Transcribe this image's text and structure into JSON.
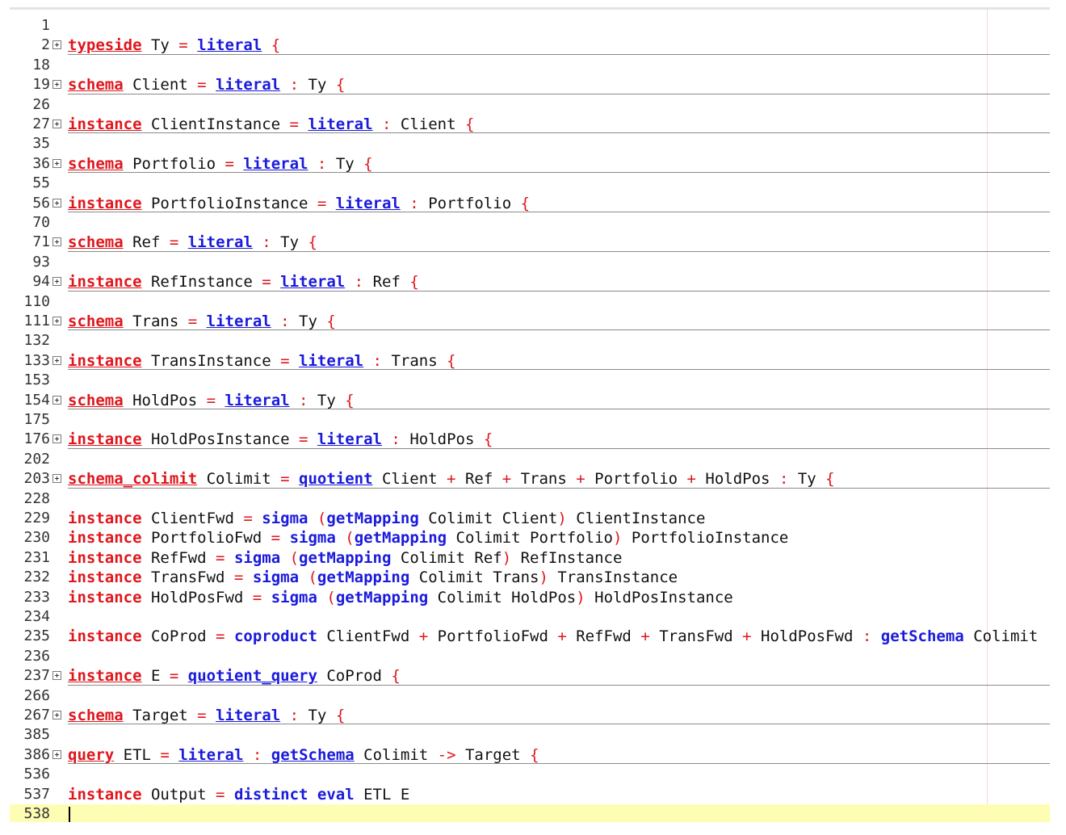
{
  "editor": {
    "current_line": "538",
    "lines": [
      {
        "num": "1",
        "fold": false,
        "tokens": []
      },
      {
        "num": "2",
        "fold": true,
        "tokens": [
          [
            "typeside",
            "kb"
          ],
          [
            " Ty ",
            ""
          ],
          [
            "=",
            "o"
          ],
          [
            " ",
            ""
          ],
          [
            "literal",
            "bb"
          ],
          [
            " ",
            ""
          ],
          [
            "{",
            "o"
          ]
        ]
      },
      {
        "num": "18",
        "fold": false,
        "tokens": []
      },
      {
        "num": "19",
        "fold": true,
        "tokens": [
          [
            "schema",
            "kb"
          ],
          [
            " Client ",
            ""
          ],
          [
            "=",
            "o"
          ],
          [
            " ",
            ""
          ],
          [
            "literal",
            "bb"
          ],
          [
            " ",
            ""
          ],
          [
            ":",
            "o"
          ],
          [
            " Ty ",
            ""
          ],
          [
            "{",
            "o"
          ]
        ]
      },
      {
        "num": "26",
        "fold": false,
        "tokens": []
      },
      {
        "num": "27",
        "fold": true,
        "tokens": [
          [
            "instance",
            "kb"
          ],
          [
            " ClientInstance ",
            ""
          ],
          [
            "=",
            "o"
          ],
          [
            " ",
            ""
          ],
          [
            "literal",
            "bb"
          ],
          [
            " ",
            ""
          ],
          [
            ":",
            "o"
          ],
          [
            " Client ",
            ""
          ],
          [
            "{",
            "o"
          ]
        ]
      },
      {
        "num": "35",
        "fold": false,
        "tokens": []
      },
      {
        "num": "36",
        "fold": true,
        "tokens": [
          [
            "schema",
            "kb"
          ],
          [
            " Portfolio ",
            ""
          ],
          [
            "=",
            "o"
          ],
          [
            " ",
            ""
          ],
          [
            "literal",
            "bb"
          ],
          [
            " ",
            ""
          ],
          [
            ":",
            "o"
          ],
          [
            " Ty ",
            ""
          ],
          [
            "{",
            "o"
          ]
        ]
      },
      {
        "num": "55",
        "fold": false,
        "tokens": []
      },
      {
        "num": "56",
        "fold": true,
        "tokens": [
          [
            "instance",
            "kb"
          ],
          [
            " PortfolioInstance ",
            ""
          ],
          [
            "=",
            "o"
          ],
          [
            " ",
            ""
          ],
          [
            "literal",
            "bb"
          ],
          [
            " ",
            ""
          ],
          [
            ":",
            "o"
          ],
          [
            " Portfolio ",
            ""
          ],
          [
            "{",
            "o"
          ]
        ]
      },
      {
        "num": "70",
        "fold": false,
        "tokens": []
      },
      {
        "num": "71",
        "fold": true,
        "tokens": [
          [
            "schema",
            "kb"
          ],
          [
            " Ref ",
            ""
          ],
          [
            "=",
            "o"
          ],
          [
            " ",
            ""
          ],
          [
            "literal",
            "bb"
          ],
          [
            " ",
            ""
          ],
          [
            ":",
            "o"
          ],
          [
            " Ty ",
            ""
          ],
          [
            "{",
            "o"
          ]
        ]
      },
      {
        "num": "93",
        "fold": false,
        "tokens": []
      },
      {
        "num": "94",
        "fold": true,
        "tokens": [
          [
            "instance",
            "kb"
          ],
          [
            " RefInstance ",
            ""
          ],
          [
            "=",
            "o"
          ],
          [
            " ",
            ""
          ],
          [
            "literal",
            "bb"
          ],
          [
            " ",
            ""
          ],
          [
            ":",
            "o"
          ],
          [
            " Ref ",
            ""
          ],
          [
            "{",
            "o"
          ]
        ]
      },
      {
        "num": "110",
        "fold": false,
        "tokens": []
      },
      {
        "num": "111",
        "fold": true,
        "tokens": [
          [
            "schema",
            "kb"
          ],
          [
            " Trans ",
            ""
          ],
          [
            "=",
            "o"
          ],
          [
            " ",
            ""
          ],
          [
            "literal",
            "bb"
          ],
          [
            " ",
            ""
          ],
          [
            ":",
            "o"
          ],
          [
            " Ty ",
            ""
          ],
          [
            "{",
            "o"
          ]
        ]
      },
      {
        "num": "132",
        "fold": false,
        "tokens": []
      },
      {
        "num": "133",
        "fold": true,
        "tokens": [
          [
            "instance",
            "kb"
          ],
          [
            " TransInstance ",
            ""
          ],
          [
            "=",
            "o"
          ],
          [
            " ",
            ""
          ],
          [
            "literal",
            "bb"
          ],
          [
            " ",
            ""
          ],
          [
            ":",
            "o"
          ],
          [
            " Trans ",
            ""
          ],
          [
            "{",
            "o"
          ]
        ]
      },
      {
        "num": "153",
        "fold": false,
        "tokens": []
      },
      {
        "num": "154",
        "fold": true,
        "tokens": [
          [
            "schema",
            "kb"
          ],
          [
            " HoldPos ",
            ""
          ],
          [
            "=",
            "o"
          ],
          [
            " ",
            ""
          ],
          [
            "literal",
            "bb"
          ],
          [
            " ",
            ""
          ],
          [
            ":",
            "o"
          ],
          [
            " Ty ",
            ""
          ],
          [
            "{",
            "o"
          ]
        ]
      },
      {
        "num": "175",
        "fold": false,
        "tokens": []
      },
      {
        "num": "176",
        "fold": true,
        "tokens": [
          [
            "instance",
            "kb"
          ],
          [
            " HoldPosInstance ",
            ""
          ],
          [
            "=",
            "o"
          ],
          [
            " ",
            ""
          ],
          [
            "literal",
            "bb"
          ],
          [
            " ",
            ""
          ],
          [
            ":",
            "o"
          ],
          [
            " HoldPos ",
            ""
          ],
          [
            "{",
            "o"
          ]
        ]
      },
      {
        "num": "202",
        "fold": false,
        "tokens": []
      },
      {
        "num": "203",
        "fold": true,
        "tokens": [
          [
            "schema_colimit",
            "kb"
          ],
          [
            " Colimit ",
            ""
          ],
          [
            "=",
            "o"
          ],
          [
            " ",
            ""
          ],
          [
            "quotient",
            "bb"
          ],
          [
            " Client ",
            ""
          ],
          [
            "+",
            "o"
          ],
          [
            " Ref ",
            ""
          ],
          [
            "+",
            "o"
          ],
          [
            " Trans ",
            ""
          ],
          [
            "+",
            "o"
          ],
          [
            " Portfolio ",
            ""
          ],
          [
            "+",
            "o"
          ],
          [
            " HoldPos ",
            ""
          ],
          [
            ":",
            "o"
          ],
          [
            " Ty ",
            ""
          ],
          [
            "{",
            "o"
          ]
        ]
      },
      {
        "num": "228",
        "fold": false,
        "tokens": []
      },
      {
        "num": "229",
        "fold": false,
        "tokens": [
          [
            "instance",
            "k"
          ],
          [
            " ClientFwd ",
            ""
          ],
          [
            "=",
            "o"
          ],
          [
            " ",
            ""
          ],
          [
            "sigma",
            "b"
          ],
          [
            " ",
            ""
          ],
          [
            "(",
            "o"
          ],
          [
            "getMapping",
            "b"
          ],
          [
            " Colimit Client",
            ""
          ],
          [
            ")",
            "o"
          ],
          [
            " ClientInstance",
            ""
          ]
        ]
      },
      {
        "num": "230",
        "fold": false,
        "tokens": [
          [
            "instance",
            "k"
          ],
          [
            " PortfolioFwd ",
            ""
          ],
          [
            "=",
            "o"
          ],
          [
            " ",
            ""
          ],
          [
            "sigma",
            "b"
          ],
          [
            " ",
            ""
          ],
          [
            "(",
            "o"
          ],
          [
            "getMapping",
            "b"
          ],
          [
            " Colimit Portfolio",
            ""
          ],
          [
            ")",
            "o"
          ],
          [
            " PortfolioInstance",
            ""
          ]
        ]
      },
      {
        "num": "231",
        "fold": false,
        "tokens": [
          [
            "instance",
            "k"
          ],
          [
            " RefFwd ",
            ""
          ],
          [
            "=",
            "o"
          ],
          [
            " ",
            ""
          ],
          [
            "sigma",
            "b"
          ],
          [
            " ",
            ""
          ],
          [
            "(",
            "o"
          ],
          [
            "getMapping",
            "b"
          ],
          [
            " Colimit Ref",
            ""
          ],
          [
            ")",
            "o"
          ],
          [
            " RefInstance",
            ""
          ]
        ]
      },
      {
        "num": "232",
        "fold": false,
        "tokens": [
          [
            "instance",
            "k"
          ],
          [
            " TransFwd ",
            ""
          ],
          [
            "=",
            "o"
          ],
          [
            " ",
            ""
          ],
          [
            "sigma",
            "b"
          ],
          [
            " ",
            ""
          ],
          [
            "(",
            "o"
          ],
          [
            "getMapping",
            "b"
          ],
          [
            " Colimit Trans",
            ""
          ],
          [
            ")",
            "o"
          ],
          [
            " TransInstance",
            ""
          ]
        ]
      },
      {
        "num": "233",
        "fold": false,
        "tokens": [
          [
            "instance",
            "k"
          ],
          [
            " HoldPosFwd ",
            ""
          ],
          [
            "=",
            "o"
          ],
          [
            " ",
            ""
          ],
          [
            "sigma",
            "b"
          ],
          [
            " ",
            ""
          ],
          [
            "(",
            "o"
          ],
          [
            "getMapping",
            "b"
          ],
          [
            " Colimit HoldPos",
            ""
          ],
          [
            ")",
            "o"
          ],
          [
            " HoldPosInstance",
            ""
          ]
        ]
      },
      {
        "num": "234",
        "fold": false,
        "tokens": []
      },
      {
        "num": "235",
        "fold": false,
        "tokens": [
          [
            "instance",
            "k"
          ],
          [
            " CoProd ",
            ""
          ],
          [
            "=",
            "o"
          ],
          [
            " ",
            ""
          ],
          [
            "coproduct",
            "b"
          ],
          [
            " ClientFwd ",
            ""
          ],
          [
            "+",
            "o"
          ],
          [
            " PortfolioFwd ",
            ""
          ],
          [
            "+",
            "o"
          ],
          [
            " RefFwd ",
            ""
          ],
          [
            "+",
            "o"
          ],
          [
            " TransFwd ",
            ""
          ],
          [
            "+",
            "o"
          ],
          [
            " HoldPosFwd ",
            ""
          ],
          [
            ":",
            "o"
          ],
          [
            " ",
            ""
          ],
          [
            "getSchema",
            "b"
          ],
          [
            " Colimit",
            ""
          ]
        ]
      },
      {
        "num": "236",
        "fold": false,
        "tokens": []
      },
      {
        "num": "237",
        "fold": true,
        "tokens": [
          [
            "instance",
            "kb"
          ],
          [
            " E ",
            ""
          ],
          [
            "=",
            "o"
          ],
          [
            " ",
            ""
          ],
          [
            "quotient_query",
            "bb"
          ],
          [
            " CoProd ",
            ""
          ],
          [
            "{",
            "o"
          ]
        ]
      },
      {
        "num": "266",
        "fold": false,
        "tokens": []
      },
      {
        "num": "267",
        "fold": true,
        "tokens": [
          [
            "schema",
            "kb"
          ],
          [
            " Target ",
            ""
          ],
          [
            "=",
            "o"
          ],
          [
            " ",
            ""
          ],
          [
            "literal",
            "bb"
          ],
          [
            " ",
            ""
          ],
          [
            ":",
            "o"
          ],
          [
            " Ty ",
            ""
          ],
          [
            "{",
            "o"
          ]
        ]
      },
      {
        "num": "385",
        "fold": false,
        "tokens": []
      },
      {
        "num": "386",
        "fold": true,
        "tokens": [
          [
            "query",
            "kb"
          ],
          [
            " ETL ",
            ""
          ],
          [
            "=",
            "o"
          ],
          [
            " ",
            ""
          ],
          [
            "literal",
            "bb"
          ],
          [
            " ",
            ""
          ],
          [
            ":",
            "o"
          ],
          [
            " ",
            ""
          ],
          [
            "getSchema",
            "bb"
          ],
          [
            " Colimit ",
            ""
          ],
          [
            "->",
            "o"
          ],
          [
            " Target ",
            ""
          ],
          [
            "{",
            "o"
          ]
        ]
      },
      {
        "num": "536",
        "fold": false,
        "tokens": []
      },
      {
        "num": "537",
        "fold": false,
        "tokens": [
          [
            "instance",
            "k"
          ],
          [
            " Output ",
            ""
          ],
          [
            "=",
            "o"
          ],
          [
            " ",
            ""
          ],
          [
            "distinct",
            "b"
          ],
          [
            " ",
            ""
          ],
          [
            "eval",
            "b"
          ],
          [
            " ETL E",
            ""
          ]
        ]
      },
      {
        "num": "538",
        "fold": false,
        "tokens": []
      }
    ]
  }
}
